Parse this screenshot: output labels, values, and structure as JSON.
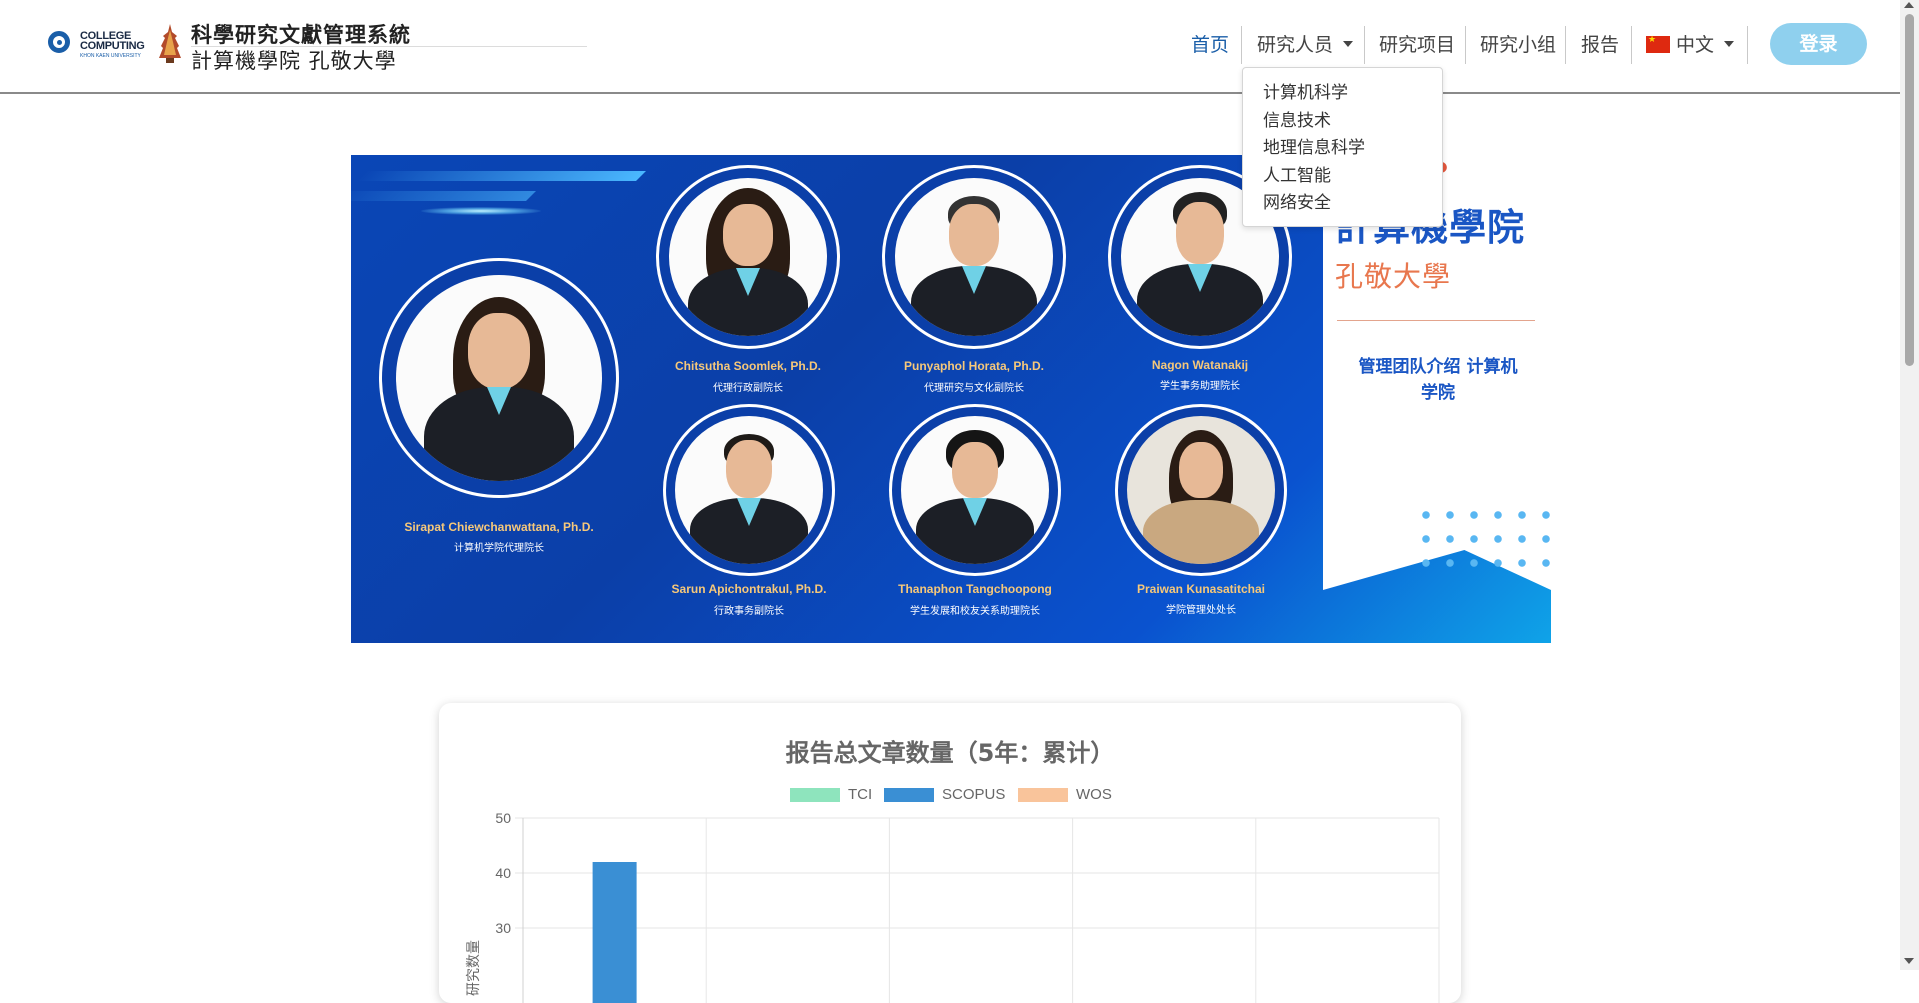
{
  "header": {
    "logo_college_line1": "COLLEGE",
    "logo_college_line2": "COMPUTING",
    "logo_college_line3": "KHON KAEN UNIVERSITY",
    "site_title": "科學研究文獻管理系統",
    "site_subtitle": "計算機學院 孔敬大學"
  },
  "nav": {
    "home": "首页",
    "researchers": "研究人员",
    "projects": "研究项目",
    "groups": "研究小组",
    "reports": "报告",
    "language": "中文",
    "login": "登录"
  },
  "researchers_dropdown": [
    "计算机科学",
    "信息技术",
    "地理信息科学",
    "人工智能",
    "网络安全"
  ],
  "banner": {
    "side_title": "計算機學院",
    "side_subtitle": "孔敬大學",
    "side_desc": "管理团队介绍 计算机学院",
    "people": [
      {
        "name": "Sirapat Chiewchanwattana, Ph.D.",
        "role": "计算机学院代理院长"
      },
      {
        "name": "Chitsutha Soomlek, Ph.D.",
        "role": "代理行政副院长"
      },
      {
        "name": "Punyaphol Horata, Ph.D.",
        "role": "代理研究与文化副院长"
      },
      {
        "name": "Nagon Watanakij",
        "role": "学生事务助理院长"
      },
      {
        "name": "Sarun Apichontrakul, Ph.D.",
        "role": "行政事务副院长"
      },
      {
        "name": "Thanaphon Tangchoopong",
        "role": "学生发展和校友关系助理院长"
      },
      {
        "name": "Praiwan Kunasatitchai",
        "role": "学院管理处处长"
      }
    ]
  },
  "chart_data": {
    "type": "bar",
    "title": "报告总文章数量（5年：累计）",
    "ylabel": "研究数量",
    "ylim": [
      0,
      50
    ],
    "yticks": [
      50,
      40,
      30
    ],
    "grid": true,
    "legend_position": "top",
    "series": [
      {
        "name": "TCI",
        "color": "#8ee4bd",
        "values": [
          null
        ]
      },
      {
        "name": "SCOPUS",
        "color": "#3a8fd4",
        "values": [
          42
        ]
      },
      {
        "name": "WOS",
        "color": "#f9c49b",
        "values": [
          null
        ]
      }
    ]
  }
}
